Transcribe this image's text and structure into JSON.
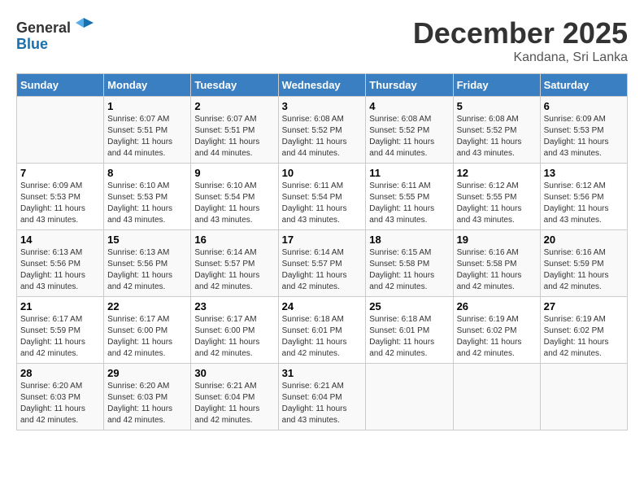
{
  "header": {
    "logo_line1": "General",
    "logo_line2": "Blue",
    "month_title": "December 2025",
    "location": "Kandana, Sri Lanka"
  },
  "days_of_week": [
    "Sunday",
    "Monday",
    "Tuesday",
    "Wednesday",
    "Thursday",
    "Friday",
    "Saturday"
  ],
  "weeks": [
    [
      {
        "num": "",
        "sunrise": "",
        "sunset": "",
        "daylight": ""
      },
      {
        "num": "1",
        "sunrise": "Sunrise: 6:07 AM",
        "sunset": "Sunset: 5:51 PM",
        "daylight": "Daylight: 11 hours and 44 minutes."
      },
      {
        "num": "2",
        "sunrise": "Sunrise: 6:07 AM",
        "sunset": "Sunset: 5:51 PM",
        "daylight": "Daylight: 11 hours and 44 minutes."
      },
      {
        "num": "3",
        "sunrise": "Sunrise: 6:08 AM",
        "sunset": "Sunset: 5:52 PM",
        "daylight": "Daylight: 11 hours and 44 minutes."
      },
      {
        "num": "4",
        "sunrise": "Sunrise: 6:08 AM",
        "sunset": "Sunset: 5:52 PM",
        "daylight": "Daylight: 11 hours and 44 minutes."
      },
      {
        "num": "5",
        "sunrise": "Sunrise: 6:08 AM",
        "sunset": "Sunset: 5:52 PM",
        "daylight": "Daylight: 11 hours and 43 minutes."
      },
      {
        "num": "6",
        "sunrise": "Sunrise: 6:09 AM",
        "sunset": "Sunset: 5:53 PM",
        "daylight": "Daylight: 11 hours and 43 minutes."
      }
    ],
    [
      {
        "num": "7",
        "sunrise": "Sunrise: 6:09 AM",
        "sunset": "Sunset: 5:53 PM",
        "daylight": "Daylight: 11 hours and 43 minutes."
      },
      {
        "num": "8",
        "sunrise": "Sunrise: 6:10 AM",
        "sunset": "Sunset: 5:53 PM",
        "daylight": "Daylight: 11 hours and 43 minutes."
      },
      {
        "num": "9",
        "sunrise": "Sunrise: 6:10 AM",
        "sunset": "Sunset: 5:54 PM",
        "daylight": "Daylight: 11 hours and 43 minutes."
      },
      {
        "num": "10",
        "sunrise": "Sunrise: 6:11 AM",
        "sunset": "Sunset: 5:54 PM",
        "daylight": "Daylight: 11 hours and 43 minutes."
      },
      {
        "num": "11",
        "sunrise": "Sunrise: 6:11 AM",
        "sunset": "Sunset: 5:55 PM",
        "daylight": "Daylight: 11 hours and 43 minutes."
      },
      {
        "num": "12",
        "sunrise": "Sunrise: 6:12 AM",
        "sunset": "Sunset: 5:55 PM",
        "daylight": "Daylight: 11 hours and 43 minutes."
      },
      {
        "num": "13",
        "sunrise": "Sunrise: 6:12 AM",
        "sunset": "Sunset: 5:56 PM",
        "daylight": "Daylight: 11 hours and 43 minutes."
      }
    ],
    [
      {
        "num": "14",
        "sunrise": "Sunrise: 6:13 AM",
        "sunset": "Sunset: 5:56 PM",
        "daylight": "Daylight: 11 hours and 43 minutes."
      },
      {
        "num": "15",
        "sunrise": "Sunrise: 6:13 AM",
        "sunset": "Sunset: 5:56 PM",
        "daylight": "Daylight: 11 hours and 42 minutes."
      },
      {
        "num": "16",
        "sunrise": "Sunrise: 6:14 AM",
        "sunset": "Sunset: 5:57 PM",
        "daylight": "Daylight: 11 hours and 42 minutes."
      },
      {
        "num": "17",
        "sunrise": "Sunrise: 6:14 AM",
        "sunset": "Sunset: 5:57 PM",
        "daylight": "Daylight: 11 hours and 42 minutes."
      },
      {
        "num": "18",
        "sunrise": "Sunrise: 6:15 AM",
        "sunset": "Sunset: 5:58 PM",
        "daylight": "Daylight: 11 hours and 42 minutes."
      },
      {
        "num": "19",
        "sunrise": "Sunrise: 6:16 AM",
        "sunset": "Sunset: 5:58 PM",
        "daylight": "Daylight: 11 hours and 42 minutes."
      },
      {
        "num": "20",
        "sunrise": "Sunrise: 6:16 AM",
        "sunset": "Sunset: 5:59 PM",
        "daylight": "Daylight: 11 hours and 42 minutes."
      }
    ],
    [
      {
        "num": "21",
        "sunrise": "Sunrise: 6:17 AM",
        "sunset": "Sunset: 5:59 PM",
        "daylight": "Daylight: 11 hours and 42 minutes."
      },
      {
        "num": "22",
        "sunrise": "Sunrise: 6:17 AM",
        "sunset": "Sunset: 6:00 PM",
        "daylight": "Daylight: 11 hours and 42 minutes."
      },
      {
        "num": "23",
        "sunrise": "Sunrise: 6:17 AM",
        "sunset": "Sunset: 6:00 PM",
        "daylight": "Daylight: 11 hours and 42 minutes."
      },
      {
        "num": "24",
        "sunrise": "Sunrise: 6:18 AM",
        "sunset": "Sunset: 6:01 PM",
        "daylight": "Daylight: 11 hours and 42 minutes."
      },
      {
        "num": "25",
        "sunrise": "Sunrise: 6:18 AM",
        "sunset": "Sunset: 6:01 PM",
        "daylight": "Daylight: 11 hours and 42 minutes."
      },
      {
        "num": "26",
        "sunrise": "Sunrise: 6:19 AM",
        "sunset": "Sunset: 6:02 PM",
        "daylight": "Daylight: 11 hours and 42 minutes."
      },
      {
        "num": "27",
        "sunrise": "Sunrise: 6:19 AM",
        "sunset": "Sunset: 6:02 PM",
        "daylight": "Daylight: 11 hours and 42 minutes."
      }
    ],
    [
      {
        "num": "28",
        "sunrise": "Sunrise: 6:20 AM",
        "sunset": "Sunset: 6:03 PM",
        "daylight": "Daylight: 11 hours and 42 minutes."
      },
      {
        "num": "29",
        "sunrise": "Sunrise: 6:20 AM",
        "sunset": "Sunset: 6:03 PM",
        "daylight": "Daylight: 11 hours and 42 minutes."
      },
      {
        "num": "30",
        "sunrise": "Sunrise: 6:21 AM",
        "sunset": "Sunset: 6:04 PM",
        "daylight": "Daylight: 11 hours and 42 minutes."
      },
      {
        "num": "31",
        "sunrise": "Sunrise: 6:21 AM",
        "sunset": "Sunset: 6:04 PM",
        "daylight": "Daylight: 11 hours and 43 minutes."
      },
      {
        "num": "",
        "sunrise": "",
        "sunset": "",
        "daylight": ""
      },
      {
        "num": "",
        "sunrise": "",
        "sunset": "",
        "daylight": ""
      },
      {
        "num": "",
        "sunrise": "",
        "sunset": "",
        "daylight": ""
      }
    ]
  ]
}
